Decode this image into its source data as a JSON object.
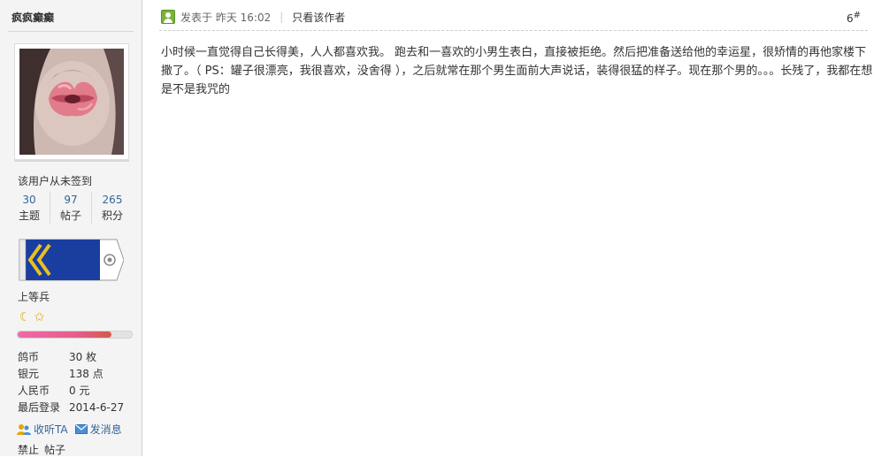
{
  "user": {
    "name": "疯疯癫癫",
    "signin_status": "该用户从未签到",
    "stats": [
      {
        "value": "30",
        "label": "主题"
      },
      {
        "value": "97",
        "label": "帖子"
      },
      {
        "value": "265",
        "label": "积分"
      }
    ],
    "rank": "上等兵",
    "rank_icons": [
      "moon-icon",
      "star-icon"
    ],
    "progress_fraction": 0.82,
    "info": [
      {
        "key": "鸽币",
        "value": "30 枚"
      },
      {
        "key": "银元",
        "value": "138 点"
      },
      {
        "key": "人民币",
        "value": "0 元"
      },
      {
        "key": "最后登录",
        "value": "2014-6-27"
      }
    ],
    "actions": {
      "follow": "收听TA",
      "message": "发消息"
    },
    "admin": {
      "ban": "禁止",
      "posts": "帖子"
    }
  },
  "post": {
    "posted_label": "发表于",
    "time": "昨天 16:02",
    "author_only": "只看该作者",
    "floor_number": "6",
    "floor_mark": "#",
    "content": "小时候一直觉得自己长得美，人人都喜欢我。    跑去和一喜欢的小男生表白，直接被拒绝。然后把准备送给他的幸运星，很矫情的再他家楼下撒了。（ PS：罐子很漂亮，我很喜欢，没舍得 ），之后就常在那个男生面前大声说话，装得很猛的样子。现在那个男的。。。长残了，我都在想是不是我咒的"
  },
  "colors": {
    "link": "#336699",
    "sidebar_bg": "#f4f4f4",
    "progress_fill": "#e85d8e",
    "badge_blue": "#1a3ea0",
    "badge_gold": "#e8c020",
    "online_green": "#7ab33a"
  }
}
